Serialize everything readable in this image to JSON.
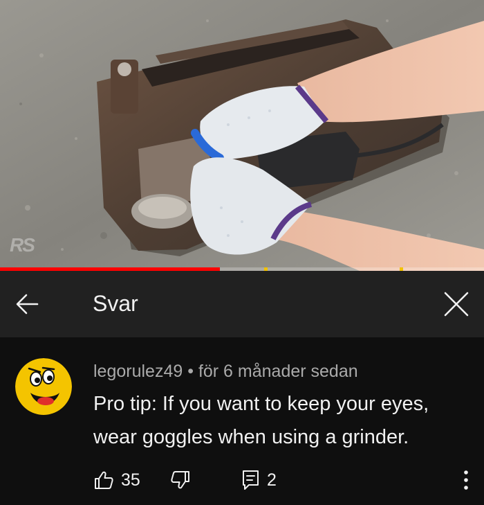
{
  "video": {
    "watermark": "RS",
    "progress": 0.454,
    "ad_markers": [
      0.545,
      0.826
    ]
  },
  "header": {
    "back_icon": "arrow-left-icon",
    "title": "Svar",
    "close_icon": "close-icon"
  },
  "comment": {
    "author": "legorulez49",
    "separator": "•",
    "timestamp": "för 6 månader sedan",
    "text": "Pro tip: If you want to keep your eyes, wear goggles when using a grinder.",
    "likes": "35",
    "replies": "2",
    "icons": {
      "like": "thumbs-up-icon",
      "dislike": "thumbs-down-icon",
      "reply": "reply-comment-icon",
      "more": "more-vertical-icon"
    }
  },
  "colors": {
    "header_bg": "#212121",
    "body_bg": "#0f0f0f",
    "text": "#f1f1f1",
    "secondary_text": "#aaaaaa",
    "progress": "#ff0000",
    "ad_marker": "#f2c200"
  }
}
